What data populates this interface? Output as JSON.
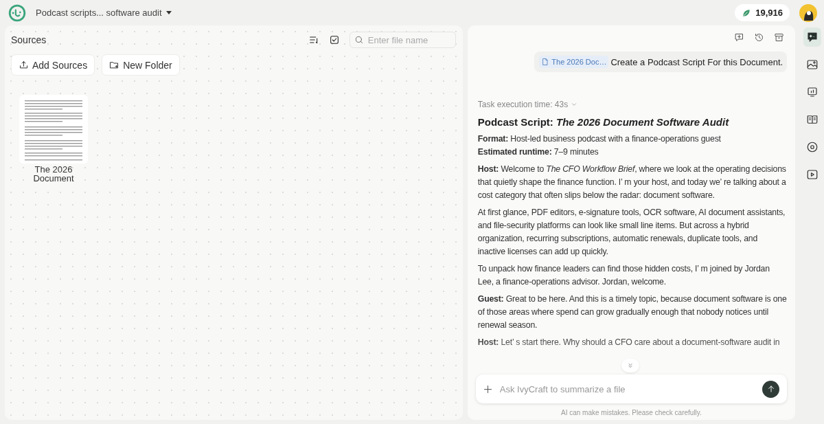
{
  "header": {
    "project_title": "Podcast scripts... software audit",
    "credits": "19,916"
  },
  "sources": {
    "title": "Sources",
    "search": {
      "placeholder": "Enter file name"
    },
    "buttons": [
      {
        "kind": "upload",
        "label": "Add Sources"
      },
      {
        "kind": "folder",
        "label": "New Folder"
      }
    ],
    "files": [
      {
        "name": "The 2026 Document"
      }
    ]
  },
  "chat": {
    "user_message": {
      "attachment": "The 2026 Doc…",
      "text": "Create a Podcast Script For this Document."
    },
    "task_time": "Task execution time: 43s",
    "heading": "Podcast Script: *The 2026 Document Software Audit*",
    "paragraphs": [
      {
        "lines": [
          "**Format:** Host-led business podcast with a finance-operations guest",
          "**Estimated runtime:** 7–9 minutes"
        ]
      },
      {
        "lines": [
          "**Host:** Welcome to *The CFO Workflow Brief*, where we look at the operating decisions that quietly shape the finance function. I’ m your host, and today we’ re talking about a cost category that often slips below the radar: document software."
        ]
      },
      {
        "lines": [
          "At first glance, PDF editors, e-signature tools, OCR software, AI document assistants, and file-security platforms can look like small line items. But across a hybrid organization, recurring subscriptions, automatic renewals, duplicate tools, and inactive licenses can add up quickly."
        ]
      },
      {
        "lines": [
          "To unpack how finance leaders can find those hidden costs, I’ m joined by Jordan Lee, a finance-operations advisor. Jordan, welcome."
        ]
      },
      {
        "lines": [
          "**Guest:** Great to be here. And this is a timely topic, because document software is one of those areas where spend can grow gradually enough that nobody notices until renewal season."
        ]
      },
      {
        "lines": [
          "**Host:** Let’ s start there. Why should a CFO care about a document-software audit in"
        ]
      }
    ],
    "input": {
      "placeholder": "Ask IvyCraft to summarize a file"
    },
    "disclaimer": "AI can make mistakes. Please check carefully."
  },
  "rail": [
    {
      "kind": "new-chat",
      "selected": true
    },
    {
      "kind": "image",
      "selected": false
    },
    {
      "kind": "slides",
      "selected": false
    },
    {
      "kind": "book",
      "selected": false
    },
    {
      "kind": "disc",
      "selected": false
    },
    {
      "kind": "video",
      "selected": false
    }
  ]
}
